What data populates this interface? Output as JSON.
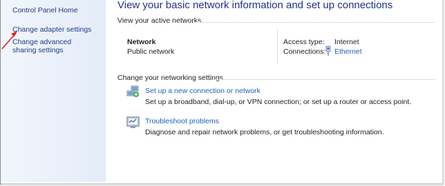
{
  "sidebar": {
    "items": [
      {
        "label": "Control Panel Home"
      },
      {
        "label": "Change adapter settings"
      },
      {
        "label": "Change advanced sharing settings"
      }
    ],
    "pointer_icon": "red-arrow-icon"
  },
  "header": {
    "title": "View your basic network information and set up connections"
  },
  "active_networks": {
    "heading": "View your active networks",
    "network_name": "Network",
    "network_type": "Public network",
    "access_type_label": "Access type:",
    "access_type_value": "Internet",
    "connections_label": "Connections:",
    "connection_name": "Ethernet",
    "connection_icon": "ethernet-adapter-icon"
  },
  "settings": {
    "heading": "Change your networking settings",
    "items": [
      {
        "title": "Set up a new connection or network",
        "description": "Set up a broadband, dial-up, or VPN connection; or set up a router or access point.",
        "icon": "new-connection-icon"
      },
      {
        "title": "Troubleshoot problems",
        "description": "Diagnose and repair network problems, or get troubleshooting information.",
        "icon": "troubleshoot-icon"
      }
    ]
  },
  "colors": {
    "link": "#1f5fbf",
    "title": "#1e3287",
    "sidebar_bg": "#e4ecf8",
    "annotation_arrow": "#e02020"
  }
}
